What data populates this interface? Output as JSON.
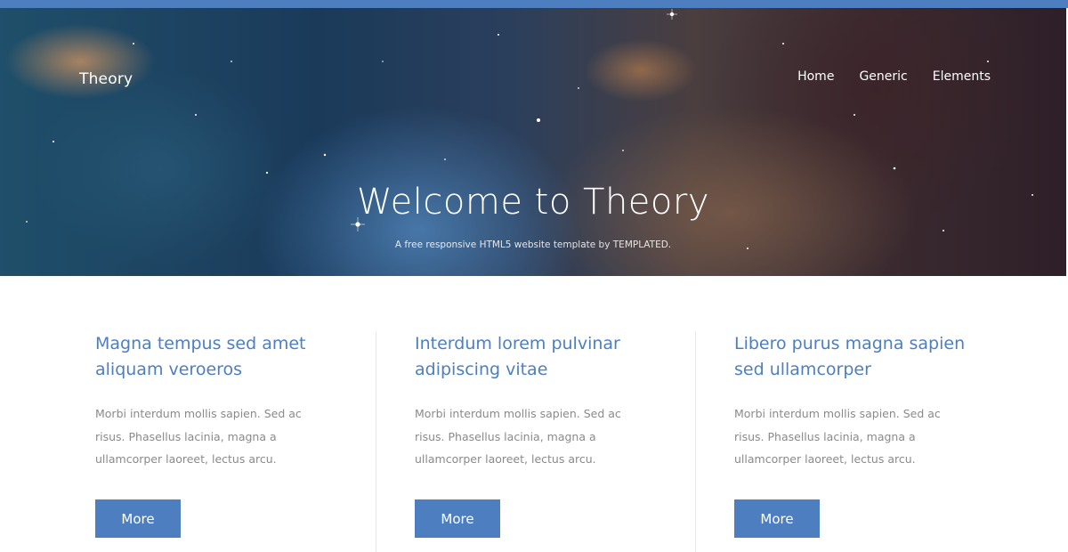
{
  "header": {
    "logo": "Theory",
    "nav": [
      {
        "label": "Home"
      },
      {
        "label": "Generic"
      },
      {
        "label": "Elements"
      }
    ]
  },
  "hero": {
    "title": "Welcome to Theory",
    "subtitle": "A free responsive HTML5 website template by TEMPLATED."
  },
  "features": [
    {
      "title_line1": "Magna tempus sed amet",
      "title_line2": "aliquam veroeros",
      "text_line1": "Morbi interdum mollis sapien. Sed ac",
      "text_line2": "risus. Phasellus lacinia, magna a",
      "text_line3": "ullamcorper laoreet, lectus arcu.",
      "button": "More"
    },
    {
      "title_line1": "Interdum lorem pulvinar",
      "title_line2": "adipiscing vitae",
      "text_line1": "Morbi interdum mollis sapien. Sed ac",
      "text_line2": "risus. Phasellus lacinia, magna a",
      "text_line3": "ullamcorper laoreet, lectus arcu.",
      "button": "More"
    },
    {
      "title_line1": "Libero purus magna sapien",
      "title_line2": "sed ullamcorper",
      "text_line1": "Morbi interdum mollis sapien. Sed ac",
      "text_line2": "risus. Phasellus lacinia, magna a",
      "text_line3": "ullamcorper laoreet, lectus arcu.",
      "button": "More"
    }
  ],
  "colors": {
    "accent": "#4d7fc0",
    "body_text": "#8a8a8a"
  }
}
